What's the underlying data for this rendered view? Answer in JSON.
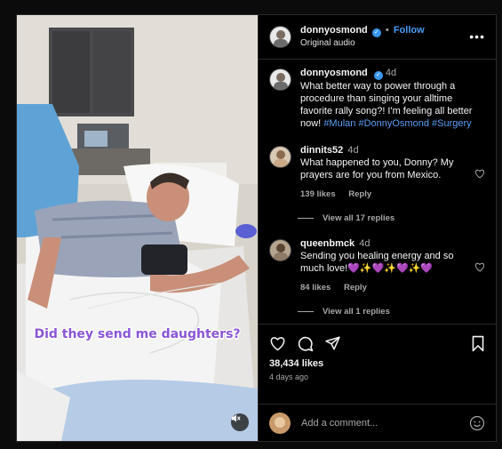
{
  "post": {
    "video_caption": "Did they send me daughters?",
    "mute_icon": "speaker-muted-icon"
  },
  "header": {
    "username": "donnyosmond",
    "separator": "•",
    "follow_label": "Follow",
    "audio": "Original audio",
    "more_label": "•••"
  },
  "caption": {
    "username": "donnyosmond",
    "time": "4d",
    "text": "What better way to power through a procedure than singing your alltime favorite rally song?! I'm feeling all better now!",
    "hashtags": "#Mulan #DonnyOsmond #Surgery"
  },
  "comments": [
    {
      "username": "dinnits52",
      "time": "4d",
      "text": "What happened to you, Donny? My prayers are for you from Mexico.",
      "likes": "139 likes",
      "reply_label": "Reply",
      "view_replies": "View all 17 replies"
    },
    {
      "username": "queenbmck",
      "time": "4d",
      "text": "Sending you healing energy and so much love!💜✨💜✨💜✨💜",
      "likes": "84 likes",
      "reply_label": "Reply",
      "view_replies": "View all 1 replies"
    }
  ],
  "stats": {
    "likes": "38,434 likes",
    "posted": "4 days ago"
  },
  "composer": {
    "placeholder": "Add a comment..."
  },
  "colors": {
    "accent_blue": "#4a9df8",
    "caption_purple": "#8a55d6",
    "background": "#000000"
  }
}
